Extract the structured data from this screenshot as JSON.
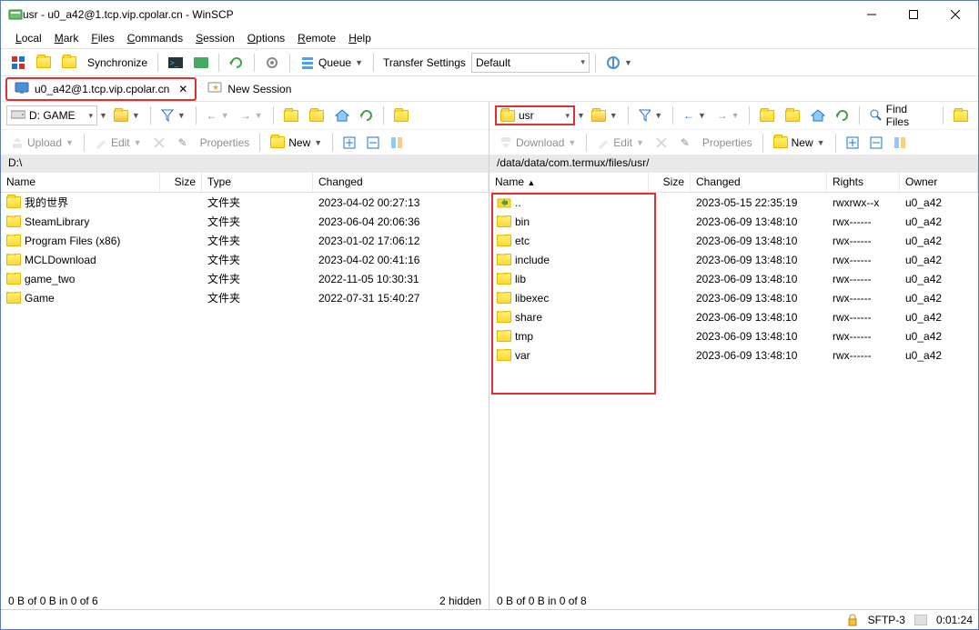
{
  "window": {
    "title": "usr - u0_a42@1.tcp.vip.cpolar.cn - WinSCP"
  },
  "menu": {
    "local": "Local",
    "mark": "Mark",
    "files": "Files",
    "commands": "Commands",
    "session": "Session",
    "options": "Options",
    "remote": "Remote",
    "help": "Help"
  },
  "maintoolbar": {
    "sync": "Synchronize",
    "queue": "Queue",
    "transfer_label": "Transfer Settings",
    "transfer_value": "Default"
  },
  "tabs": {
    "session": "u0_a42@1.tcp.vip.cpolar.cn",
    "new_session": "New Session"
  },
  "left": {
    "drive": "D: GAME",
    "actions": {
      "upload": "Upload",
      "edit": "Edit",
      "properties": "Properties",
      "new": "New"
    },
    "path": "D:\\",
    "cols": {
      "name": "Name",
      "size": "Size",
      "type": "Type",
      "changed": "Changed"
    },
    "items": [
      {
        "name": "我的世界",
        "type": "文件夹",
        "changed": "2023-04-02  00:27:13"
      },
      {
        "name": "SteamLibrary",
        "type": "文件夹",
        "changed": "2023-06-04  20:06:36"
      },
      {
        "name": "Program Files (x86)",
        "type": "文件夹",
        "changed": "2023-01-02  17:06:12"
      },
      {
        "name": "MCLDownload",
        "type": "文件夹",
        "changed": "2023-04-02  00:41:16"
      },
      {
        "name": "game_two",
        "type": "文件夹",
        "changed": "2022-11-05  10:30:31"
      },
      {
        "name": "Game",
        "type": "文件夹",
        "changed": "2022-07-31  15:40:27"
      }
    ],
    "status_left": "0 B of 0 B in 0 of 6",
    "status_right": "2 hidden"
  },
  "right": {
    "drive": "usr",
    "find": "Find Files",
    "actions": {
      "download": "Download",
      "edit": "Edit",
      "properties": "Properties",
      "new": "New"
    },
    "path": "/data/data/com.termux/files/usr/",
    "cols": {
      "name": "Name",
      "size": "Size",
      "changed": "Changed",
      "rights": "Rights",
      "owner": "Owner"
    },
    "items": [
      {
        "name": "..",
        "up": true,
        "changed": "2023-05-15 22:35:19",
        "rights": "rwxrwx--x",
        "owner": "u0_a42"
      },
      {
        "name": "bin",
        "changed": "2023-06-09 13:48:10",
        "rights": "rwx------",
        "owner": "u0_a42"
      },
      {
        "name": "etc",
        "changed": "2023-06-09 13:48:10",
        "rights": "rwx------",
        "owner": "u0_a42"
      },
      {
        "name": "include",
        "changed": "2023-06-09 13:48:10",
        "rights": "rwx------",
        "owner": "u0_a42"
      },
      {
        "name": "lib",
        "changed": "2023-06-09 13:48:10",
        "rights": "rwx------",
        "owner": "u0_a42"
      },
      {
        "name": "libexec",
        "changed": "2023-06-09 13:48:10",
        "rights": "rwx------",
        "owner": "u0_a42"
      },
      {
        "name": "share",
        "changed": "2023-06-09 13:48:10",
        "rights": "rwx------",
        "owner": "u0_a42"
      },
      {
        "name": "tmp",
        "changed": "2023-06-09 13:48:10",
        "rights": "rwx------",
        "owner": "u0_a42"
      },
      {
        "name": "var",
        "changed": "2023-06-09 13:48:10",
        "rights": "rwx------",
        "owner": "u0_a42"
      }
    ],
    "status": "0 B of 0 B in 0 of 8"
  },
  "statusbar": {
    "protocol": "SFTP-3",
    "time": "0:01:24"
  }
}
